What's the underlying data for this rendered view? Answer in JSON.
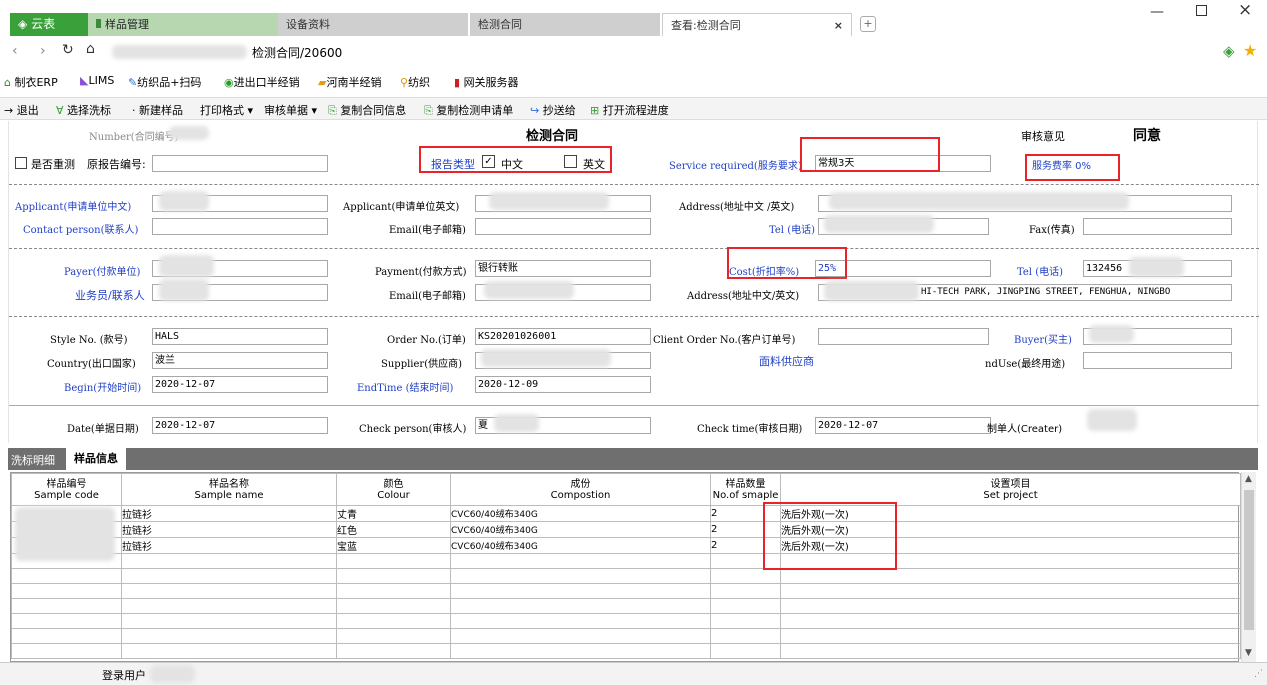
{
  "tabs": {
    "home": "云表",
    "t1": "样品管理",
    "t2": "设备资料",
    "t3": "检测合同",
    "t4": "查看:检测合同"
  },
  "nav": {
    "path": "检测合同/20600"
  },
  "bookmarks": [
    "制衣ERP",
    "LIMS",
    "纺织品+扫码",
    "进出口半经销",
    "河南半经销",
    "纺织",
    "网关服务器"
  ],
  "toolbar": [
    "退出",
    "选择洗标",
    "新建样品",
    "打印格式",
    "审核单据",
    "复制合同信息",
    "复制检测申请单",
    "抄送给",
    "打开流程进度"
  ],
  "form": {
    "number_label": "Number(合同编号)",
    "title": "检测合同",
    "audit_label": "审核意见",
    "audit_value": "同意",
    "recheck_label": "是否重测",
    "orig_report_label": "原报告编号:",
    "report_type_label": "报告类型",
    "chinese": "中文",
    "english": "英文",
    "service_label": "Service required(服务要求)",
    "service_value": "常规3天",
    "fee_rate": "服务费率 0%",
    "applicant_cn_label": "Applicant(申请单位中文)",
    "applicant_en_label": "Applicant(申请单位英文)",
    "address_label": "Address(地址中文 /英文)",
    "contact_label": "Contact person(联系人)",
    "email_label": "Email(电子邮箱)",
    "tel_label": "Tel (电话)",
    "fax_label": "Fax(传真)",
    "payer_label": "Payer(付款单位)",
    "payment_label": "Payment(付款方式)",
    "payment_value": "银行转账",
    "cost_label": "Cost(折扣率%)",
    "cost_value": "25%",
    "tel2_value": "132456",
    "sales_label": "业务员/联系人",
    "email2_label": "Email(电子邮箱)",
    "address2_label": "Address(地址中文/英文)",
    "address2_value": "HI-TECH PARK, JINGPING STREET, FENGHUA, NINGBO",
    "style_label": "Style No. (款号)",
    "style_value": "HALS",
    "order_label": "Order No.(订单)",
    "order_value": "KS20201026001",
    "client_order_label": "Client Order No.(客户订单号)",
    "buyer_label": "Buyer(买主)",
    "country_label": "Country(出口国家)",
    "country_value": "波兰",
    "supplier_label": "Supplier(供应商)",
    "fabric_supplier_label": "面料供应商",
    "enduse_label": "ndUse(最终用途)",
    "begin_label": "Begin(开始时间)",
    "begin_value": "2020-12-07",
    "end_label": "EndTime (结束时间)",
    "end_value": "2020-12-09",
    "date_label": "Date(单据日期)",
    "date_value": "2020-12-07",
    "check_person_label": "Check person(审核人)",
    "check_person_value": "夏",
    "check_time_label": "Check time(审核日期)",
    "check_time_value": "2020-12-07",
    "creator_label": "制单人(Creater)"
  },
  "subtabs": {
    "wash": "洗标明细",
    "sample": "样品信息"
  },
  "grid": {
    "headers": [
      {
        "cn": "样品编号",
        "en": "Sample code"
      },
      {
        "cn": "样品名称",
        "en": "Sample name"
      },
      {
        "cn": "颜色",
        "en": "Colour"
      },
      {
        "cn": "成份",
        "en": "Compostion"
      },
      {
        "cn": "样品数量",
        "en": "No.of smaple"
      },
      {
        "cn": "设置项目",
        "en": "Set project"
      }
    ],
    "rows": [
      {
        "name": "拉链衫",
        "colour": "丈青",
        "comp": "CVC60/40绒布340G",
        "qty": "2",
        "project": "洗后外观(一次)"
      },
      {
        "name": "拉链衫",
        "colour": "红色",
        "comp": "CVC60/40绒布340G",
        "qty": "2",
        "project": "洗后外观(一次)"
      },
      {
        "name": "拉链衫",
        "colour": "宝蓝",
        "comp": "CVC60/40绒布340G",
        "qty": "2",
        "project": "洗后外观(一次)"
      }
    ]
  },
  "status": {
    "user_label": "登录用户"
  },
  "colors": {
    "accent_blue": "#1f3fc6",
    "highlight_red": "#e8232a",
    "home_tab": "#3aa03a"
  }
}
